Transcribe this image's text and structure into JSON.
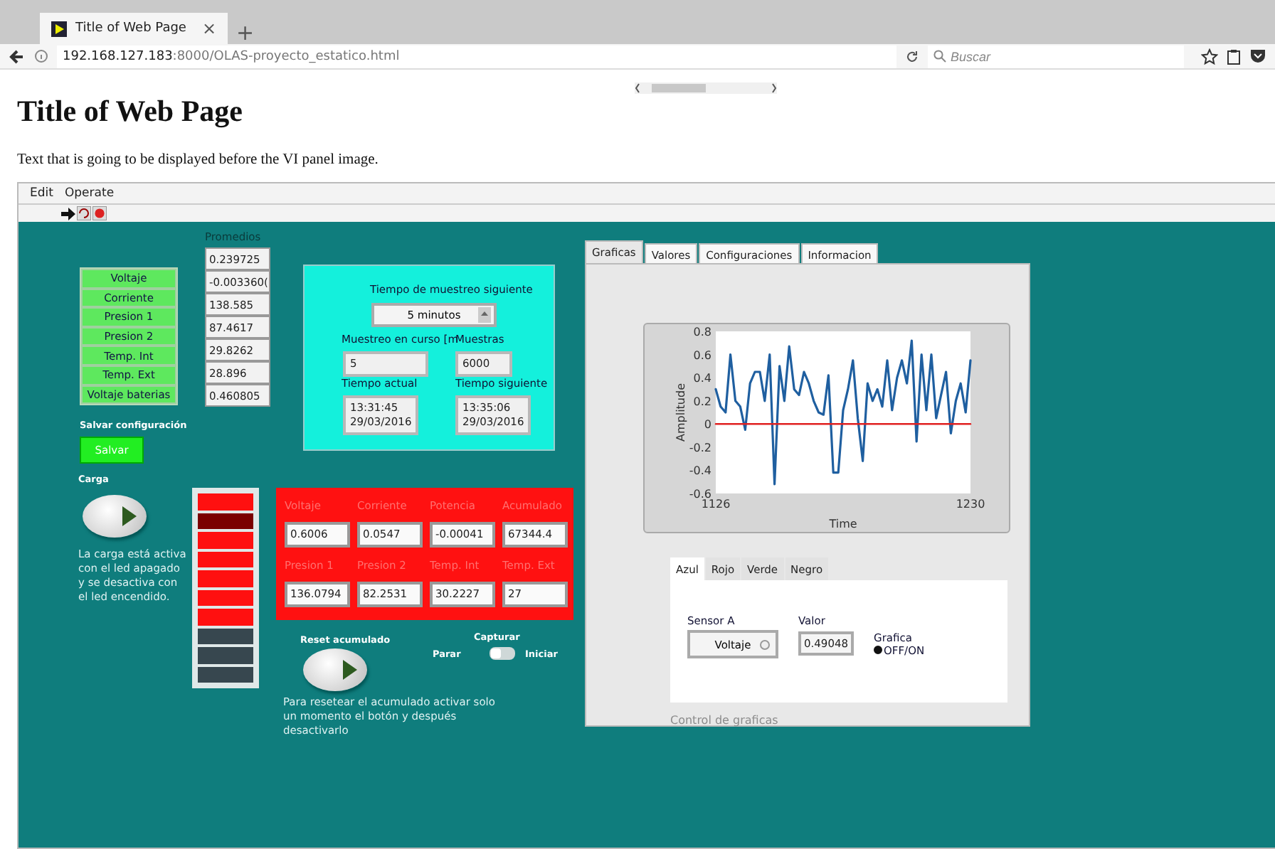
{
  "browser": {
    "tab_title": "Title of Web Page",
    "tab_close": "×",
    "new_tab": "+",
    "url_host": "192.168.127.183",
    "url_rest": ":8000/OLAS-proyecto_estatico.html",
    "search_placeholder": "Buscar"
  },
  "page": {
    "heading": "Title of Web Page",
    "intro": "Text that is going to be displayed before the VI panel image."
  },
  "vi_panel": {
    "menu": [
      "Edit",
      "Operate"
    ],
    "sensor_buttons": [
      {
        "label": "Voltaje",
        "on": true
      },
      {
        "label": "Corriente",
        "on": true
      },
      {
        "label": "Presion 1",
        "on": true
      },
      {
        "label": "Presion 2",
        "on": true
      },
      {
        "label": "Temp. Int",
        "on": true
      },
      {
        "label": "Temp. Ext",
        "on": true
      },
      {
        "label": "Voltaje baterias",
        "on": true
      }
    ],
    "promedios": {
      "label": "Promedios",
      "values": [
        "0.239725",
        "-0.003360(",
        "138.585",
        "87.4617",
        "29.8262",
        "28.896",
        "0.460805"
      ]
    },
    "salvar": {
      "label": "Salvar configuración",
      "button": "Salvar"
    },
    "muestreo": {
      "title": "Tiempo de muestreo siguiente",
      "interval": "5 minutos",
      "en_curso_label": "Muestreo en curso [m",
      "en_curso": "5",
      "muestras_label": "Muestras",
      "muestras": "6000",
      "actual_label": "Tiempo actual",
      "actual": [
        "13:31:45",
        "29/03/2016"
      ],
      "siguiente_label": "Tiempo siguiente",
      "siguiente": [
        "13:35:06",
        "29/03/2016"
      ]
    },
    "carga": {
      "label": "Carga",
      "on": false,
      "note": "La carga está activa con el led apagado y se desactiva con el led encendido."
    },
    "leds": [
      {
        "color": "#ff1010"
      },
      {
        "color": "#7a0000"
      },
      {
        "color": "#ff1010"
      },
      {
        "color": "#ff1010"
      },
      {
        "color": "#ff1010"
      },
      {
        "color": "#ff1010"
      },
      {
        "color": "#ff1010"
      },
      {
        "color": "#37474f"
      },
      {
        "color": "#37474f"
      },
      {
        "color": "#37474f"
      }
    ],
    "readings": [
      {
        "label": "Voltaje",
        "value": "0.6006"
      },
      {
        "label": "Corriente",
        "value": "0.0547"
      },
      {
        "label": "Potencia",
        "value": "-0.00041"
      },
      {
        "label": "Acumulado",
        "value": "67344.4"
      },
      {
        "label": "Presion 1",
        "value": "136.0794"
      },
      {
        "label": "Presion 2",
        "value": "82.2531"
      },
      {
        "label": "Temp. Int",
        "value": "30.2227"
      },
      {
        "label": "Temp. Ext",
        "value": "27"
      }
    ],
    "reset": {
      "label": "Reset acumulado",
      "on": false,
      "note": "Para resetear el acumulado activar solo un momento el botón y después desactivarlo"
    },
    "capturar": {
      "label": "Capturar",
      "off_label": "Parar",
      "on_label": "Iniciar",
      "on": false
    },
    "tabs": [
      {
        "label": "Graficas",
        "selected": true
      },
      {
        "label": "Valores",
        "selected": false
      },
      {
        "label": "Configuraciones",
        "selected": false
      },
      {
        "label": "Informacion",
        "selected": false
      }
    ],
    "chart_data": {
      "type": "line",
      "xlabel": "Time",
      "ylabel": "Amplitude",
      "x": [
        1126,
        1128,
        1130,
        1132,
        1134,
        1136,
        1138,
        1140,
        1142,
        1144,
        1146,
        1148,
        1150,
        1152,
        1154,
        1156,
        1158,
        1160,
        1162,
        1164,
        1166,
        1168,
        1170,
        1172,
        1174,
        1176,
        1178,
        1180,
        1182,
        1184,
        1186,
        1188,
        1190,
        1192,
        1194,
        1196,
        1198,
        1200,
        1202,
        1204,
        1206,
        1208,
        1210,
        1212,
        1214,
        1216,
        1218,
        1220,
        1222,
        1224,
        1226,
        1228,
        1230
      ],
      "xlim": [
        1126,
        1230
      ],
      "ylim": [
        -0.6,
        0.8
      ],
      "xticks": [
        1126,
        1230
      ],
      "yticks": [
        -0.6,
        -0.4,
        -0.2,
        0,
        0.2,
        0.4,
        0.6,
        0.8
      ],
      "series": [
        {
          "color": "#1f5fa0",
          "values": [
            0.3,
            0.15,
            0.1,
            0.6,
            0.2,
            0.15,
            -0.05,
            0.35,
            0.45,
            0.45,
            0.2,
            0.6,
            -0.52,
            0.5,
            0.2,
            0.67,
            0.3,
            0.25,
            0.45,
            0.35,
            0.2,
            0.1,
            0.08,
            0.42,
            -0.42,
            -0.42,
            0.12,
            0.3,
            0.55,
            0.05,
            -0.32,
            0.35,
            0.2,
            0.3,
            0.15,
            0.55,
            0.12,
            0.4,
            0.55,
            0.35,
            0.72,
            -0.15,
            0.6,
            0.12,
            0.6,
            0.05,
            0.25,
            0.45,
            -0.08,
            0.2,
            0.35,
            0.1,
            0.55
          ]
        },
        {
          "color": "#e02020",
          "values": [
            0,
            0,
            0,
            0,
            0,
            0,
            0,
            0,
            0,
            0,
            0,
            0,
            0,
            0,
            0,
            0,
            0,
            0,
            0,
            0,
            0,
            0,
            0,
            0,
            0,
            0,
            0,
            0,
            0,
            0,
            0,
            0,
            0,
            0,
            0,
            0,
            0,
            0,
            0,
            0,
            0,
            0,
            0,
            0,
            0,
            0,
            0,
            0,
            0,
            0,
            0,
            0,
            0
          ]
        }
      ]
    },
    "graph_tabs": [
      {
        "label": "Azul",
        "selected": true
      },
      {
        "label": "Rojo",
        "selected": false
      },
      {
        "label": "Verde",
        "selected": false
      },
      {
        "label": "Negro",
        "selected": false
      }
    ],
    "sensor": {
      "label": "Sensor A",
      "value": "Voltaje"
    },
    "valor": {
      "label": "Valor",
      "value": "0.49048"
    },
    "grafica": {
      "label": "Grafica",
      "option": "OFF/ON",
      "selected": true
    },
    "footer": "Control de graficas"
  }
}
